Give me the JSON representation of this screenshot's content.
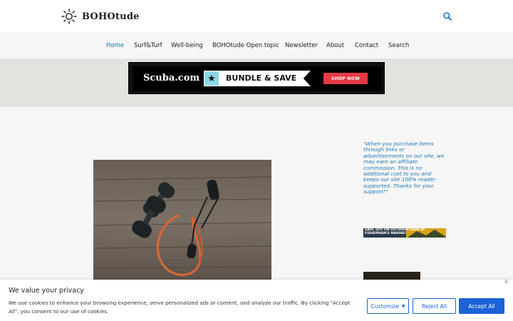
{
  "header": {
    "logo_text": "BOHOtude",
    "search_icon": "search-icon"
  },
  "nav": {
    "items": [
      {
        "label": "Home",
        "active": true
      },
      {
        "label": "Surf&Turf",
        "active": false
      },
      {
        "label": "Well-being",
        "active": false
      },
      {
        "label": "BOHOtude Open topic",
        "active": false
      },
      {
        "label": "Newsletter",
        "active": false
      },
      {
        "label": "About",
        "active": false
      },
      {
        "label": "Contact",
        "active": false
      },
      {
        "label": "Search",
        "active": false
      }
    ]
  },
  "ad": {
    "brand": "Scuba.com",
    "headline": "BUNDLE & SAVE",
    "cta": "SHOP NOW",
    "star_icon": "star-icon"
  },
  "sidebar": {
    "affiliate_note": "\"When you purchase items through links or advertisements on our site, we may earn an affiliate commission. This is no additional cost to you and keeps our site 100% reader supported. Thanks for your support!\"",
    "side_ad_text": "SAVE 10% ON OUTDOOR GEAR AT FISHERMAN'S MARINE!"
  },
  "cookie": {
    "title": "We value your privacy",
    "text": "We use cookies to enhance your browsing experience, serve personalized ads or content, and analyze our traffic. By clicking \"Accept All\", you consent to our use of cookies.",
    "customize_label": "Customize",
    "reject_label": "Reject All",
    "accept_label": "Accept All",
    "close_glyph": "✕"
  },
  "colors": {
    "accent": "#1d77b6",
    "button_blue": "#1b62d6",
    "ad_red": "#e53945"
  }
}
